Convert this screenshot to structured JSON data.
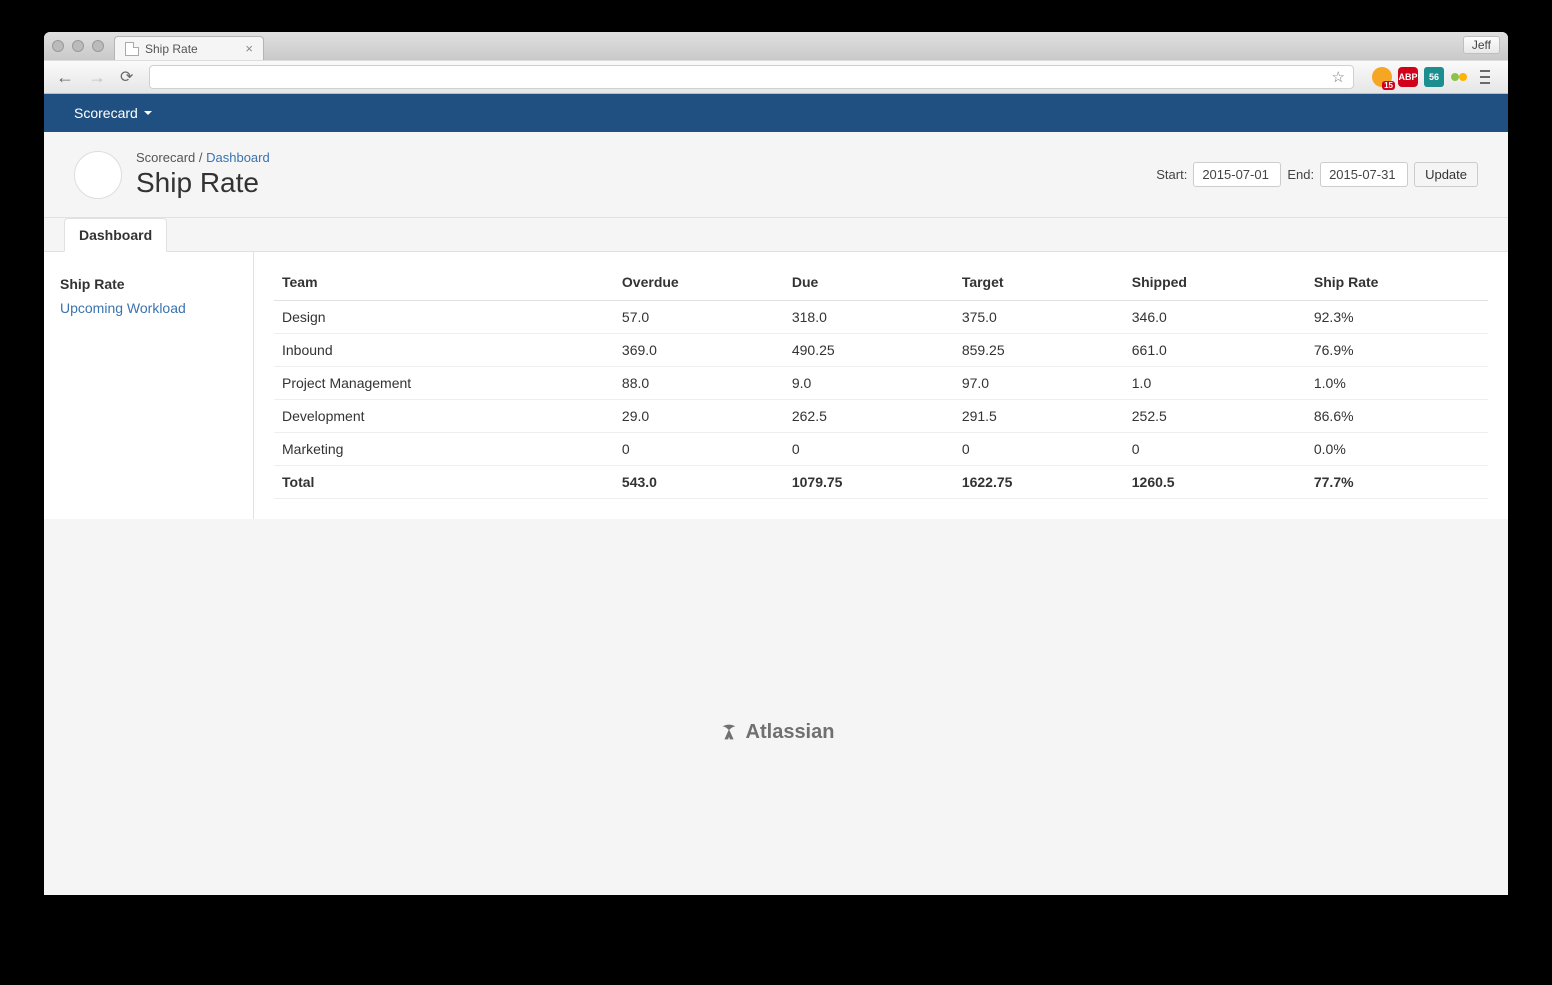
{
  "browser": {
    "tab_title": "Ship Rate",
    "user_label": "Jeff",
    "ext_orange_badge": "15",
    "ext_red_label": "ABP",
    "ext_teal_label": "56"
  },
  "appnav": {
    "menu_label": "Scorecard"
  },
  "header": {
    "breadcrumb_root": "Scorecard",
    "breadcrumb_sep": "/",
    "breadcrumb_link": "Dashboard",
    "title": "Ship Rate",
    "start_label": "Start:",
    "start_value": "2015-07-01",
    "end_label": "End:",
    "end_value": "2015-07-31",
    "update_label": "Update"
  },
  "tabs": {
    "active": "Dashboard"
  },
  "sidebar": {
    "items": [
      {
        "label": "Ship Rate",
        "active": true
      },
      {
        "label": "Upcoming Workload",
        "active": false
      }
    ]
  },
  "table": {
    "headers": [
      "Team",
      "Overdue",
      "Due",
      "Target",
      "Shipped",
      "Ship Rate"
    ],
    "rows": [
      {
        "cells": [
          "Design",
          "57.0",
          "318.0",
          "375.0",
          "346.0",
          "92.3%"
        ]
      },
      {
        "cells": [
          "Inbound",
          "369.0",
          "490.25",
          "859.25",
          "661.0",
          "76.9%"
        ]
      },
      {
        "cells": [
          "Project Management",
          "88.0",
          "9.0",
          "97.0",
          "1.0",
          "1.0%"
        ]
      },
      {
        "cells": [
          "Development",
          "29.0",
          "262.5",
          "291.5",
          "252.5",
          "86.6%"
        ]
      },
      {
        "cells": [
          "Marketing",
          "0",
          "0",
          "0",
          "0",
          "0.0%"
        ]
      }
    ],
    "total": {
      "cells": [
        "Total",
        "543.0",
        "1079.75",
        "1622.75",
        "1260.5",
        "77.7%"
      ]
    }
  },
  "footer": {
    "brand": "Atlassian"
  },
  "chart_data": {
    "type": "table",
    "title": "Ship Rate",
    "columns": [
      "Team",
      "Overdue",
      "Due",
      "Target",
      "Shipped",
      "Ship Rate %"
    ],
    "rows": [
      [
        "Design",
        57.0,
        318.0,
        375.0,
        346.0,
        92.3
      ],
      [
        "Inbound",
        369.0,
        490.25,
        859.25,
        661.0,
        76.9
      ],
      [
        "Project Management",
        88.0,
        9.0,
        97.0,
        1.0,
        1.0
      ],
      [
        "Development",
        29.0,
        262.5,
        291.5,
        252.5,
        86.6
      ],
      [
        "Marketing",
        0,
        0,
        0,
        0,
        0.0
      ]
    ],
    "total": [
      "Total",
      543.0,
      1079.75,
      1622.75,
      1260.5,
      77.7
    ]
  }
}
